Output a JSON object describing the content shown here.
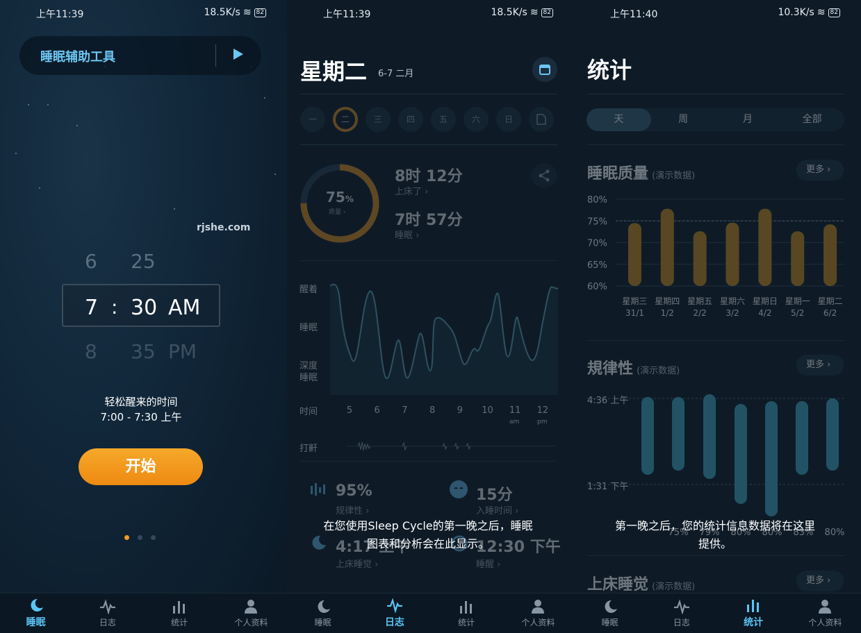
{
  "panels": [
    {
      "status": {
        "time": "上午11:39",
        "speed": "18.5K/s",
        "battery": "82"
      }
    },
    {
      "status": {
        "time": "上午11:39",
        "speed": "18.5K/s",
        "battery": "82"
      }
    },
    {
      "status": {
        "time": "上午11:40",
        "speed": "10.3K/s",
        "battery": "82"
      }
    }
  ],
  "sleep": {
    "tool_label": "睡眠辅助工具",
    "watermark": "rjshe.com",
    "picker": {
      "above": {
        "hour": "6",
        "min": "25"
      },
      "selected": {
        "hour": "7",
        "sep": ":",
        "min": "30",
        "ampm": "AM"
      },
      "below": {
        "hour": "8",
        "min": "35",
        "ampm": "PM"
      }
    },
    "wake_title": "轻松醒来的时间",
    "wake_range": "7:00 - 7:30 上午",
    "start_label": "开始",
    "accent": "#f39a1e"
  },
  "journal": {
    "day_title": "星期二",
    "date_range": "6-7 二月",
    "weekdays": [
      "一",
      "二",
      "三",
      "四",
      "五",
      "六",
      "日"
    ],
    "quality_pct": "75",
    "quality_unit": "%",
    "quality_label": "质量 ›",
    "quality_value": 0.75,
    "in_bed_value": "8时 12分",
    "in_bed_label": "上床了 ›",
    "asleep_value": "7时 57分",
    "asleep_label": "睡眠 ›",
    "y_labels": {
      "awake": "醒着",
      "sleep": "睡眠",
      "deep1": "深度",
      "deep2": "睡眠"
    },
    "time_label": "时间",
    "hours": [
      "5",
      "6",
      "7",
      "8",
      "9",
      "10",
      "11",
      "12"
    ],
    "am": "am",
    "pm": "pm",
    "snore_label": "打鼾",
    "stats": [
      {
        "value": "95%",
        "label": "规律性 ›"
      },
      {
        "value": "15分",
        "label": "入睡时间 ›"
      },
      {
        "value": "4:17 上午",
        "label": "上床睡觉 ›"
      },
      {
        "value": "12:30 下午",
        "label": "睡醒 ›"
      }
    ],
    "overlay_line1": "在您使用Sleep Cycle的第一晚之后，睡眠",
    "overlay_line2": "图表和分析会在此显示。"
  },
  "stats": {
    "title": "统计",
    "tabs": [
      "天",
      "周",
      "月",
      "全部"
    ],
    "quality": {
      "title": "睡眠质量",
      "demo": "(演示数据)",
      "more": "更多"
    },
    "regularity": {
      "title": "規律性",
      "demo": "(演示数据)",
      "more": "更多",
      "top_label": "4:36 上午",
      "mid_label": "1:31 下午"
    },
    "bedtime": {
      "title": "上床睡觉",
      "demo": "(演示数据)",
      "more": "更多"
    },
    "reg_pcts": [
      "75%",
      "79%",
      "80%",
      "80%",
      "83%",
      "80%"
    ],
    "overlay_line1": "第一晚之后，您的统计信息数据将在这里",
    "overlay_line2": "提供。"
  },
  "chart_data": {
    "type": "bar",
    "title": "睡眠质量",
    "categories": [
      "星期三 31/1",
      "星期四 1/2",
      "星期五 2/2",
      "星期六 3/2",
      "星期日 4/2",
      "星期一 5/2",
      "星期二 6/2"
    ],
    "values": [
      74.5,
      77.8,
      72.6,
      74.6,
      77.8,
      72.6,
      74.2
    ],
    "ylim": [
      60,
      80
    ],
    "yticks": [
      "60%",
      "65%",
      "70%",
      "75%",
      "80%"
    ],
    "reference_line": 75,
    "bar_color": "#c98a1c"
  },
  "nav": [
    {
      "label": "睡眠",
      "icon": "moon-icon"
    },
    {
      "label": "日志",
      "icon": "pulse-icon"
    },
    {
      "label": "统计",
      "icon": "bars-icon"
    },
    {
      "label": "个人资料",
      "icon": "person-icon"
    }
  ],
  "colors": {
    "active_nav": "#5cc4f5",
    "accent": "#f39a1e",
    "bg": "#0e1b27"
  }
}
